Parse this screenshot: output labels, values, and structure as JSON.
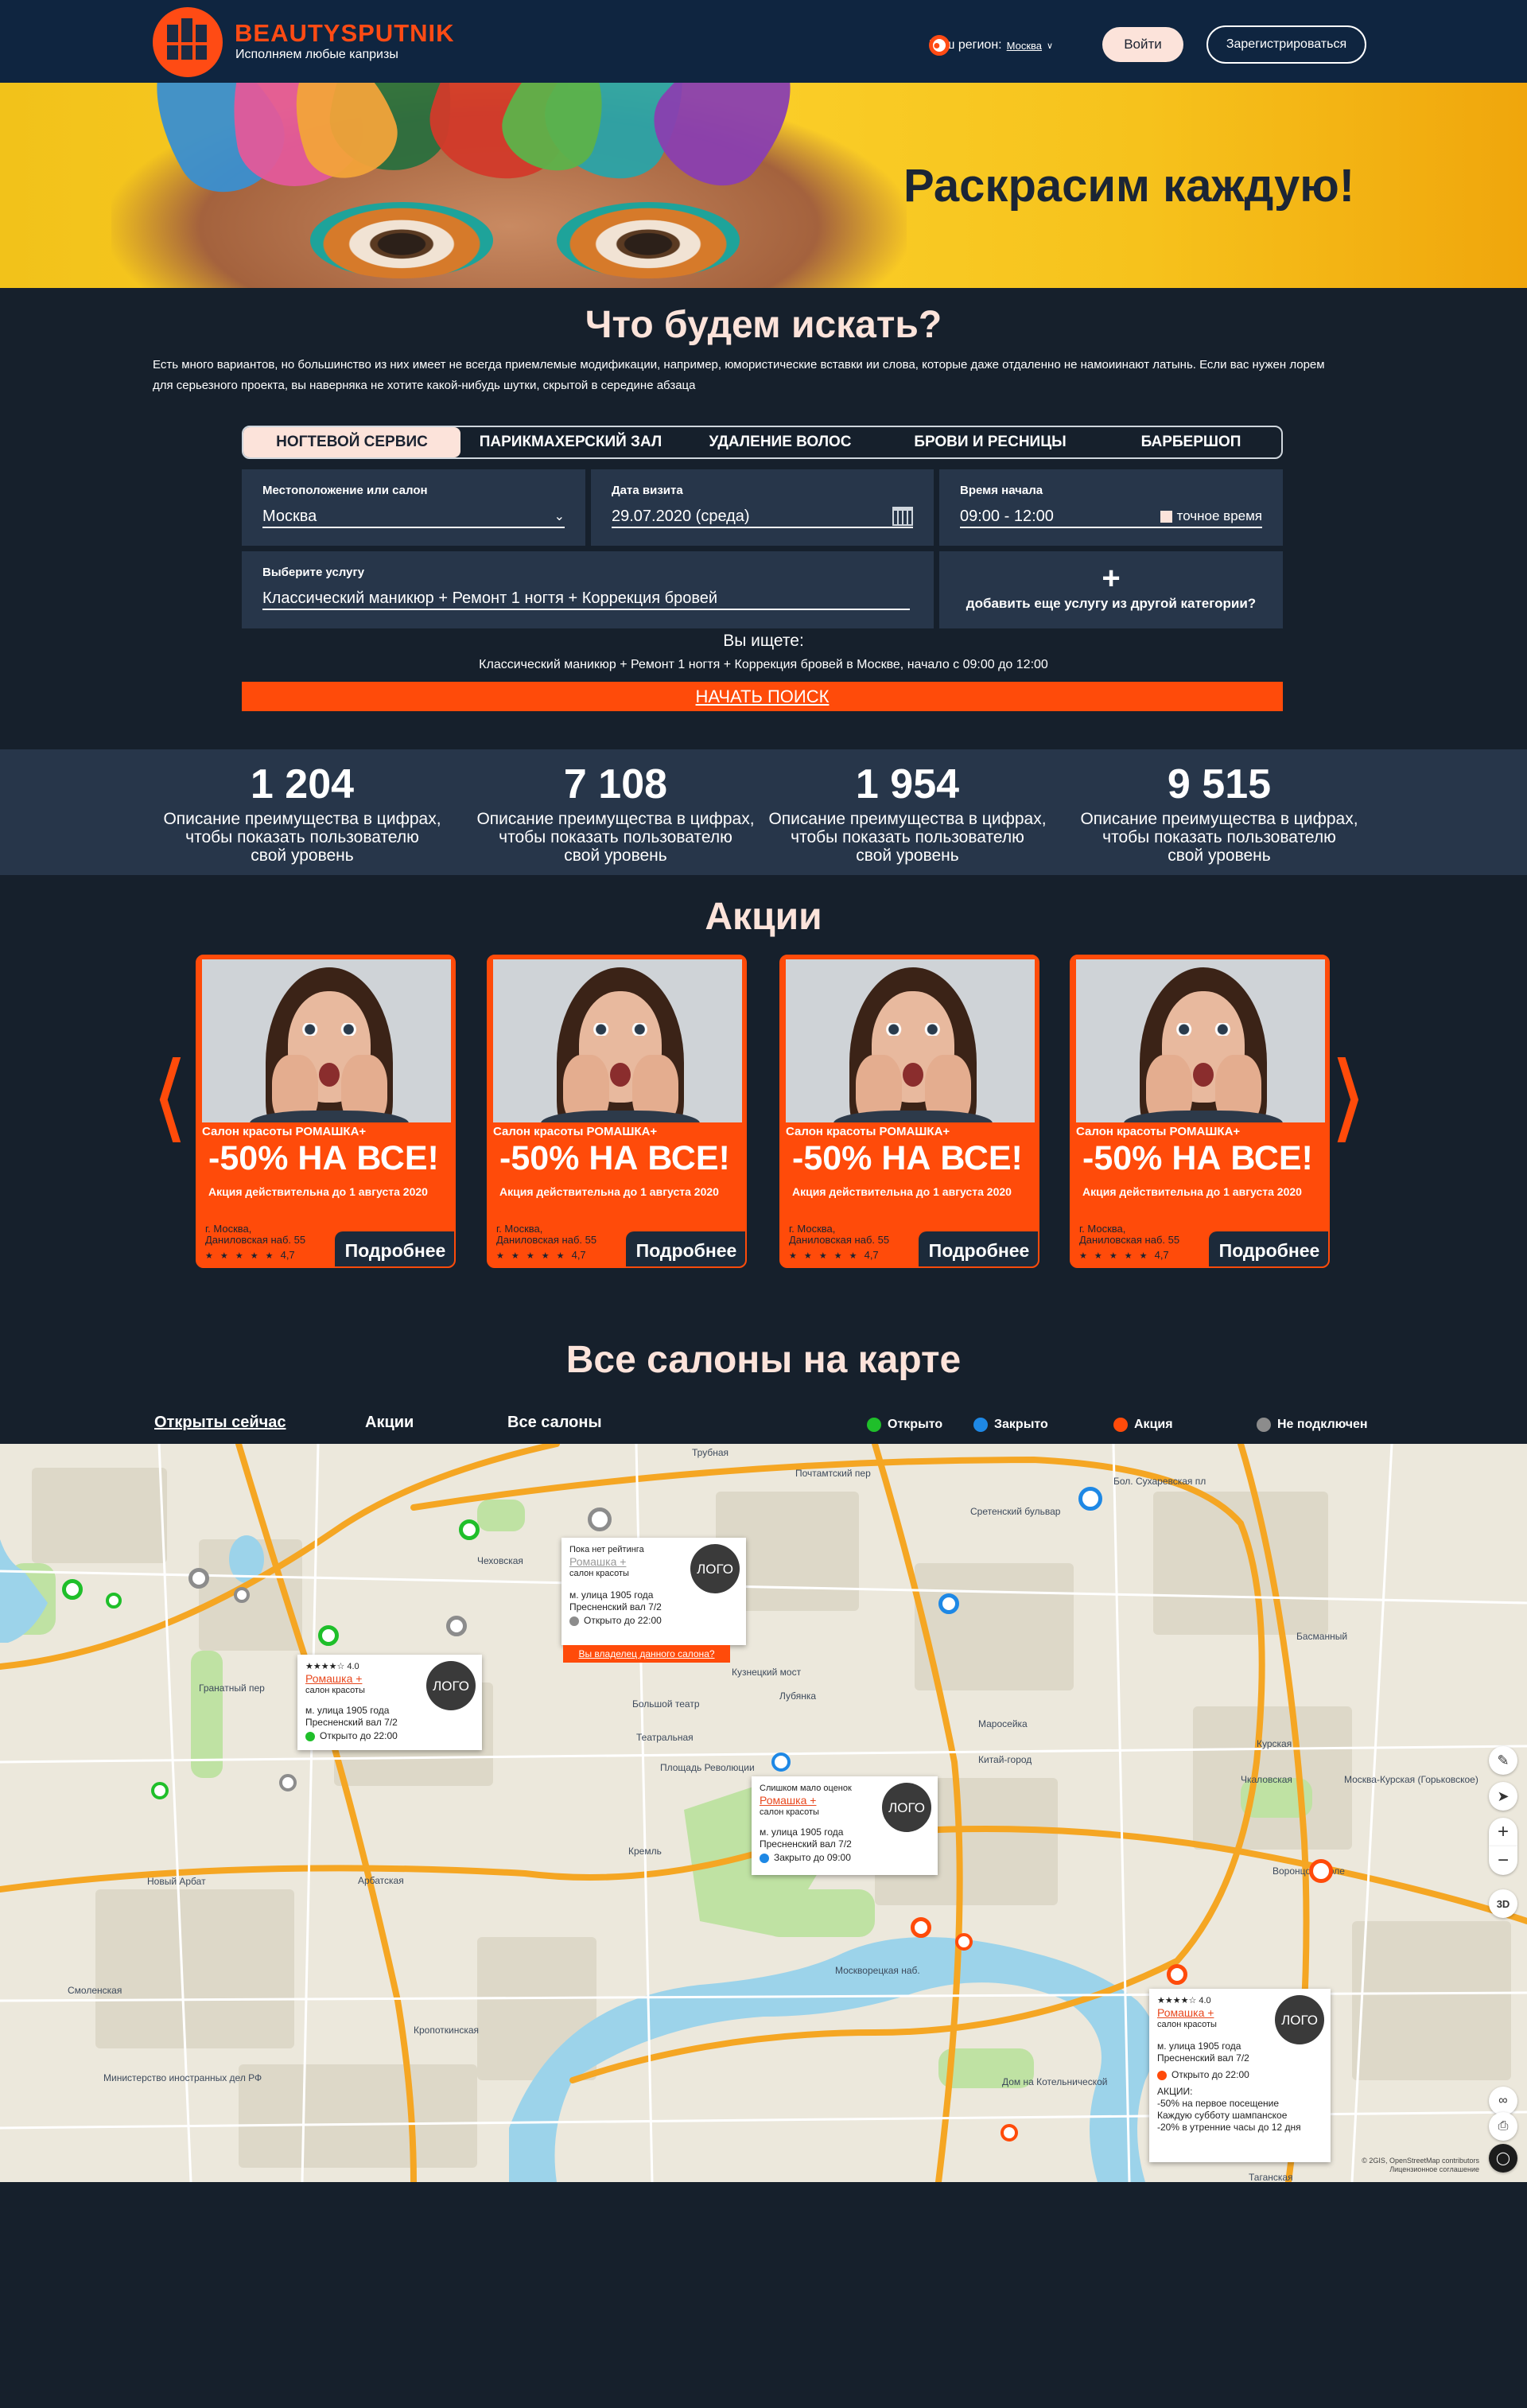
{
  "header": {
    "brand": "BEAUTYSPUTNIK",
    "tagline": "Исполняем любые капризы",
    "region_label": "Ваш регион:",
    "region_city": "Москва",
    "login": "Войти",
    "register": "Зарегистрироваться"
  },
  "hero": {
    "title": "Раскрасим каждую!"
  },
  "search": {
    "title": "Что будем искать?",
    "description": "Есть много вариантов, но большинство из них имеет не всегда приемлемые модификации, например, юмористические вставки ии слова, которые даже отдаленно не намоиинают латынь. Если вас нужен лорем для серьезного проекта, вы наверняка не хотите какой-нибудь шутки, скрытой в середине абзаца",
    "tabs": [
      "НОГТЕВОЙ СЕРВИС",
      "ПАРИКМАХЕРСКИЙ ЗАЛ",
      "УДАЛЕНИЕ ВОЛОС",
      "БРОВИ И РЕСНИЦЫ",
      "БАРБЕРШОП"
    ],
    "location_label": "Местоположение или салон",
    "location_value": "Москва",
    "date_label": "Дата визита",
    "date_value": "29.07.2020 (среда)",
    "time_label": "Время начала",
    "time_value": "09:00 - 12:00",
    "exact_time": "точное время",
    "service_label": "Выберите услугу",
    "service_value": "Классический маникюр + Ремонт 1 ногтя + Коррекция бровей",
    "add_service": "добавить еще услугу из другой категории?",
    "looking_for": "Вы ищете:",
    "summary": "Классический маникюр + Ремонт 1 ногтя + Коррекция бровей в Москве, начало с 09:00 до 12:00",
    "start": "НАЧАТЬ ПОИСК"
  },
  "stats": [
    {
      "value": "1 204",
      "line1": "Описание преимущества в цифрах,",
      "line2": "чтобы показать пользователю",
      "line3": "свой уровень"
    },
    {
      "value": "7 108",
      "line1": "Описание преимущества в цифрах,",
      "line2": "чтобы показать пользователю",
      "line3": "свой уровень"
    },
    {
      "value": "1 954",
      "line1": "Описание преимущества в цифрах,",
      "line2": "чтобы показать пользователю",
      "line3": "свой уровень"
    },
    {
      "value": "9 515",
      "line1": "Описание преимущества в цифрах,",
      "line2": "чтобы показать пользователю",
      "line3": "свой уровень"
    }
  ],
  "promos": {
    "title": "Акции",
    "cards": [
      {
        "salon": "Салон красоты РОМАШКА+",
        "discount": "-50% НА ВСЕ!",
        "until": "Акция действительна до 1 августа 2020",
        "city": "г. Москва,",
        "address": "Даниловская наб. 55",
        "stars": "★ ★ ★ ★ ★",
        "rating": "4,7",
        "more": "Подробнее"
      },
      {
        "salon": "Салон красоты РОМАШКА+",
        "discount": "-50% НА ВСЕ!",
        "until": "Акция действительна до 1 августа 2020",
        "city": "г. Москва,",
        "address": "Даниловская наб. 55",
        "stars": "★ ★ ★ ★ ★",
        "rating": "4,7",
        "more": "Подробнее"
      },
      {
        "salon": "Салон красоты РОМАШКА+",
        "discount": "-50% НА ВСЕ!",
        "until": "Акция действительна до 1 августа 2020",
        "city": "г. Москва,",
        "address": "Даниловская наб. 55",
        "stars": "★ ★ ★ ★ ★",
        "rating": "4,7",
        "more": "Подробнее"
      },
      {
        "salon": "Салон красоты РОМАШКА+",
        "discount": "-50% НА ВСЕ!",
        "until": "Акция действительна до 1 августа 2020",
        "city": "г. Москва,",
        "address": "Даниловская наб. 55",
        "stars": "★ ★ ★ ★ ★",
        "rating": "4,7",
        "more": "Подробнее"
      }
    ]
  },
  "map": {
    "title": "Все салоны на карте",
    "filters": [
      "Открыты сейчас",
      "Акции",
      "Все салоны"
    ],
    "legend": [
      {
        "label": "Открыто",
        "color": "#1fbf2a"
      },
      {
        "label": "Закрыто",
        "color": "#1e88e5"
      },
      {
        "label": "Акция",
        "color": "#ff4b0a"
      },
      {
        "label": "Не подключен",
        "color": "#8c8c8c"
      }
    ],
    "labels": [
      "Трубная",
      "Почтамтский пер",
      "Сретенский бульвар",
      "Бол. Сухаревская пл",
      "Чеховская",
      "Кузнецкий мост",
      "Лубянка",
      "Большой театр",
      "Театральная",
      "Площадь Революции",
      "Маросейка",
      "Китай-город",
      "Кремль",
      "Арбатская",
      "Смоленская",
      "Кропоткинская",
      "Дом на Котельнической",
      "Курская",
      "Басманный",
      "Москва-Курская (Горьковское)",
      "Чкаловская",
      "Воронцово поле",
      "Таганская",
      "Москворецкая наб.",
      "Министерство иностранных дел РФ",
      "Новый Арбат",
      "Гранатный пер"
    ],
    "attribution": "© 2GIS, OpenStreetMap contributors",
    "license": "Лицензионное соглашение",
    "popups": [
      {
        "rating_text": "Пока нет рейтинга",
        "name": "Ромашка +",
        "type": "салон красоты",
        "metro": "м. улица 1905 года",
        "address": "Пресненский вал 7/2",
        "status": "Открыто до 22:00",
        "logo": "ЛОГО",
        "owner": "Вы владелец данного салона?"
      },
      {
        "stars": "★★★★☆",
        "rating": "4.0",
        "name": "Ромашка +",
        "type": "салон красоты",
        "metro": "м. улица 1905 года",
        "address": "Пресненский вал 7/2",
        "status": "Открыто до 22:00",
        "logo": "ЛОГО"
      },
      {
        "rating_text": "Слишком мало оценок",
        "name": "Ромашка +",
        "type": "салон красоты",
        "metro": "м. улица 1905 года",
        "address": "Пресненский вал 7/2",
        "status": "Закрыто до 09:00",
        "logo": "ЛОГО"
      },
      {
        "stars": "★★★★☆",
        "rating": "4.0",
        "name": "Ромашка +",
        "type": "салон красоты",
        "metro": "м. улица 1905 года",
        "address": "Пресненский вал 7/2",
        "status": "Открыто до 22:00",
        "logo": "ЛОГО",
        "promo_title": "АКЦИИ:",
        "promo1": "-50% на первое посещение",
        "promo2": "Каждую субботу шампанское",
        "promo3": "-20% в утренние часы до 12 дня"
      }
    ],
    "controls": {
      "layers": "✎",
      "locate": "➤",
      "zoom_in": "+",
      "zoom_out": "−",
      "mode3d": "3D"
    }
  }
}
